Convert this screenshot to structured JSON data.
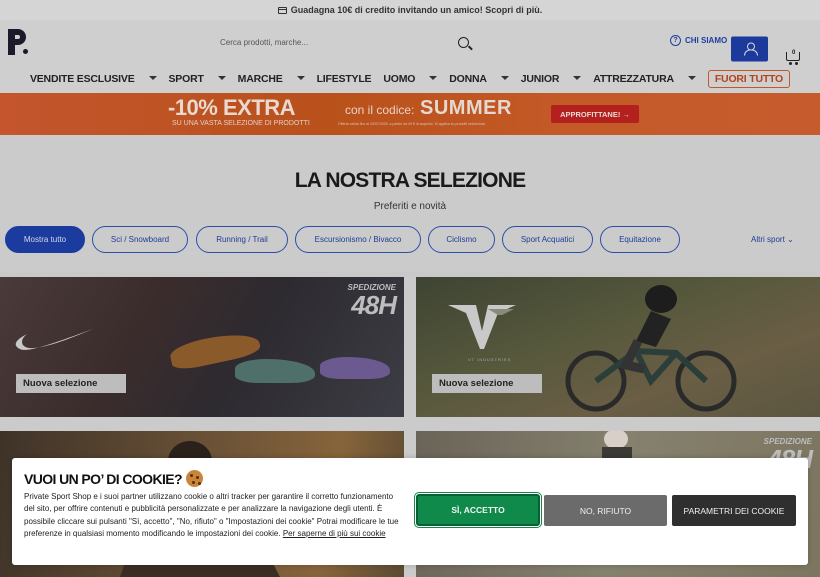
{
  "topbar": {
    "text": "Guadagna 10€ di credito invitando un amico! Scopri di più."
  },
  "header": {
    "search_placeholder": "Cerca prodotti, marche...",
    "about_label": "CHI SIAMO",
    "cart_count": "0"
  },
  "nav": {
    "items": [
      {
        "label": "VENDITE ESCLUSIVE"
      },
      {
        "label": "SPORT"
      },
      {
        "label": "MARCHE"
      },
      {
        "label": "LIFESTYLE"
      },
      {
        "label": "UOMO"
      },
      {
        "label": "DONNA"
      },
      {
        "label": "JUNIOR"
      },
      {
        "label": "ATTREZZATURA"
      }
    ],
    "sale_label": "FUORI TUTTO"
  },
  "promo": {
    "headline": "-10% EXTRA",
    "subline": "SU UNA VASTA SELEZIONE DI PRODOTTI",
    "code_label": "con il codice:",
    "code": "SUMMER",
    "fine_print": "Offerta valida fino al 20/07/2025, a partire da 49 € di acquisto. Si applica su prodotti selezionati.",
    "cta": "APPROFITTANE! →"
  },
  "selection": {
    "title": "LA NOSTRA SELEZIONE",
    "subtitle": "Preferiti e novità"
  },
  "filters": {
    "pills": [
      {
        "label": "Mostra tutto"
      },
      {
        "label": "Sci / Snowboard"
      },
      {
        "label": "Running / Trail"
      },
      {
        "label": "Escursionismo / Bivacco"
      },
      {
        "label": "Ciclismo"
      },
      {
        "label": "Sport Acquatici"
      },
      {
        "label": "Equitazione"
      }
    ],
    "more_label": "Altri sport ⌄"
  },
  "tiles": [
    {
      "label": "Nuova selezione",
      "badge_top": "SPEDIZIONE",
      "badge_main": "48H"
    },
    {
      "label": "Nuova selezione",
      "brand_sub": "VT INDUSTRIES"
    },
    {
      "label": ""
    },
    {
      "badge_top": "SPEDIZIONE",
      "badge_main": "48H"
    }
  ],
  "cookie": {
    "title": "VUOI UN PO’ DI COOKIE?",
    "body": "Private Sport Shop e i suoi partner utilizzano cookie o altri tracker per garantire il corretto funzionamento del sito, per offrire contenuti e pubblicità personalizzate e per analizzare la navigazione degli utenti. È possibile cliccare sui pulsanti \"Sì, accetto\", \"No, rifiuto\" o \"Impostazioni dei cookie\" Potrai modificare le tue preferenze in qualsiasi momento modificando le impostazioni dei cookie.",
    "link": "Per saperne di più sui cookie",
    "accept": "SÌ, ACCETTO",
    "refuse": "NO, RIFIUTO",
    "params": "PARAMETRI DEI COOKIE"
  },
  "colors": {
    "primary": "#1c3b9e",
    "accept": "#0f8a4b",
    "sale": "#b4431c",
    "promo": "#c4552d"
  }
}
